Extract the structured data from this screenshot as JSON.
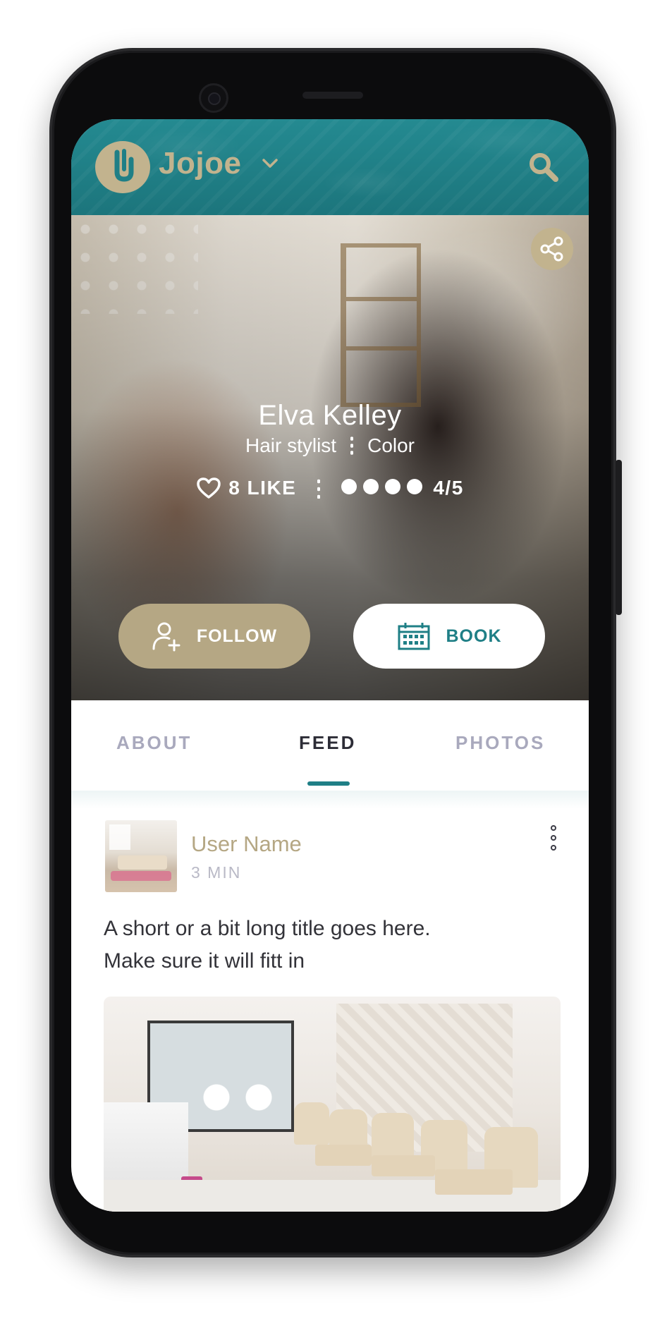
{
  "header": {
    "brand": "Jojoe",
    "logo_letter": "J",
    "icons": {
      "menu_caret": "chevron-down-icon",
      "search": "search-icon"
    }
  },
  "profile": {
    "name": "Elva Kelley",
    "role_primary": "Hair stylist",
    "role_secondary": "Color",
    "likes_label": "8 LIKE",
    "rating_dots": 4,
    "rating_label": "4/5",
    "follow_label": "FOLLOW",
    "book_label": "BOOK",
    "icons": {
      "share": "share-icon",
      "heart": "heart-icon",
      "follow": "add-user-icon",
      "book": "calendar-icon"
    }
  },
  "tabs": [
    {
      "label": "ABOUT",
      "active": false
    },
    {
      "label": "FEED",
      "active": true
    },
    {
      "label": "PHOTOS",
      "active": false
    }
  ],
  "post": {
    "user_name": "User Name",
    "time": "3 MIN",
    "title_lines": [
      "A short or a bit long title goes here.",
      "Make sure it will fitt in"
    ]
  },
  "colors": {
    "teal": "#1f7f86",
    "gold": "#b5a784",
    "gold_light": "#c2b38e",
    "tab_inactive": "#a9a9bd",
    "text_dark": "#333339"
  }
}
